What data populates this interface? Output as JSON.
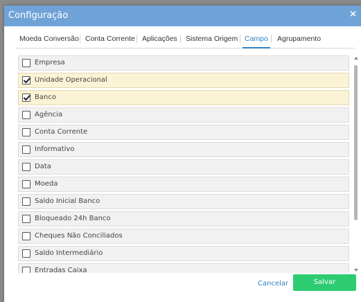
{
  "dialog": {
    "title": "Configuração",
    "close_glyph": "×"
  },
  "tabs": [
    {
      "label": "Moeda Conversão",
      "active": false
    },
    {
      "label": "Conta Corrente",
      "active": false
    },
    {
      "label": "Aplicações",
      "active": false
    },
    {
      "label": "Sistema Origem",
      "active": false
    },
    {
      "label": "Campo",
      "active": true
    },
    {
      "label": "Agrupamento",
      "active": false
    }
  ],
  "fields": [
    {
      "label": "Empresa",
      "checked": false
    },
    {
      "label": "Unidade Operacional",
      "checked": true
    },
    {
      "label": "Banco",
      "checked": true
    },
    {
      "label": "Agência",
      "checked": false
    },
    {
      "label": "Conta Corrente",
      "checked": false
    },
    {
      "label": "Informativo",
      "checked": false
    },
    {
      "label": "Data",
      "checked": false
    },
    {
      "label": "Moeda",
      "checked": false
    },
    {
      "label": "Saldo Inicial Banco",
      "checked": false
    },
    {
      "label": "Bloqueado 24h Banco",
      "checked": false
    },
    {
      "label": "Cheques Não Conciliados",
      "checked": false
    },
    {
      "label": "Saldo Intermediário",
      "checked": false
    },
    {
      "label": "Entradas Caixa",
      "checked": false
    }
  ],
  "footer": {
    "cancel_label": "Cancelar",
    "save_label": "Salvar"
  },
  "colors": {
    "titlebar": "#6fa3d8",
    "accent": "#2f7fc1",
    "save": "#2ecc71",
    "checked_row": "#fbf3d5"
  }
}
